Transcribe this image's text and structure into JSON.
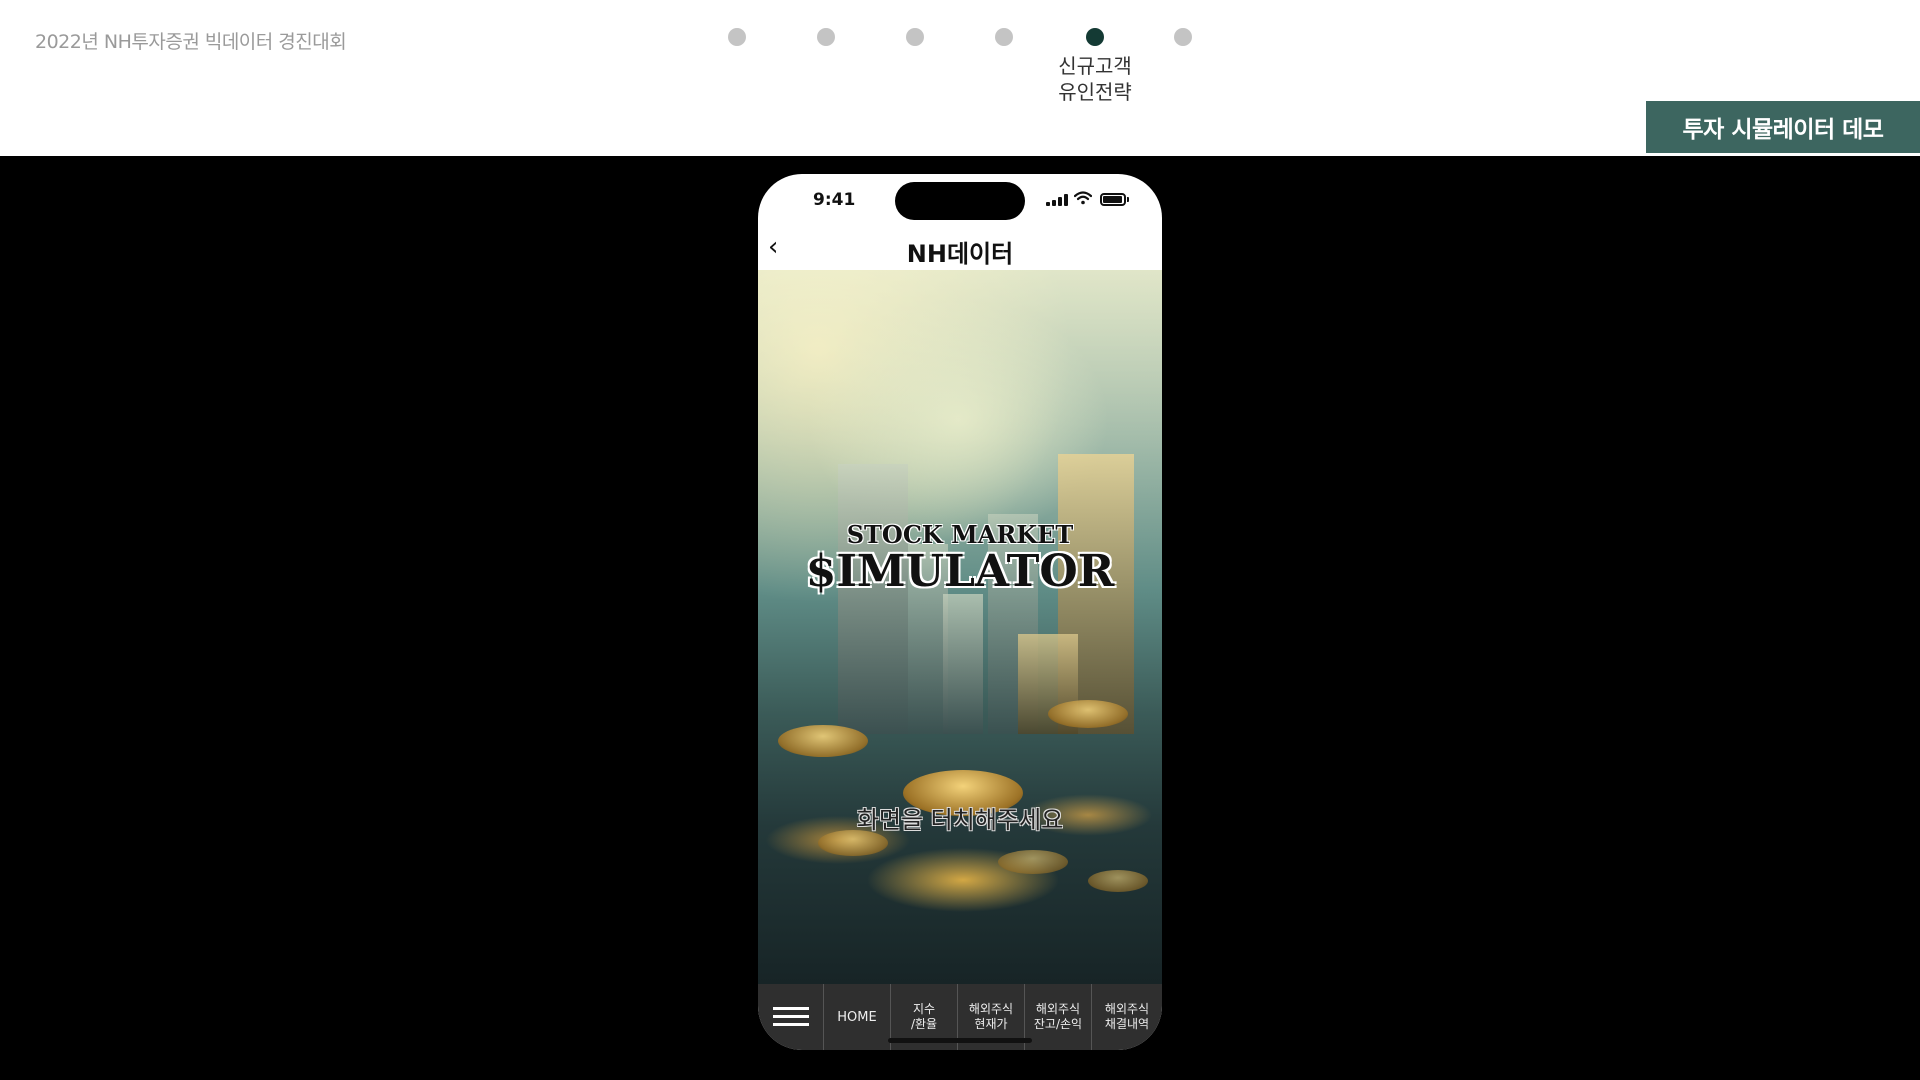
{
  "header": {
    "contest_title": "2022년 NH투자증권 빅데이터 경진대회",
    "active_step_label": "신규고객\n유인전략",
    "demo_tag": "투자 시뮬레이터 데모"
  },
  "progress": {
    "total_steps": 6,
    "active_step": 5
  },
  "phone": {
    "status_time": "9:41",
    "wifi_icon": "wifi-icon",
    "nav": {
      "back_label": "‹",
      "title": "NH데이터"
    },
    "hero": {
      "title_small": "STOCK MARKET",
      "title_big": "$IMULATOR",
      "touch_hint": "화면을 터치해주세요"
    },
    "tabbar": {
      "menu_icon": "hamburger-menu-icon",
      "home": "HOME",
      "tab_index": "지수\n/환율",
      "tab_price": "해외주식\n현재가",
      "tab_balance": "해외주식\n잔고/손익",
      "tab_history": "해외주식\n채결내역"
    }
  },
  "colors": {
    "accent": "#3d6660",
    "active_dot": "#143a34",
    "inactive_dot": "#c4c4c4",
    "stage": "#000000",
    "tabbar": "#2f2f2f"
  }
}
